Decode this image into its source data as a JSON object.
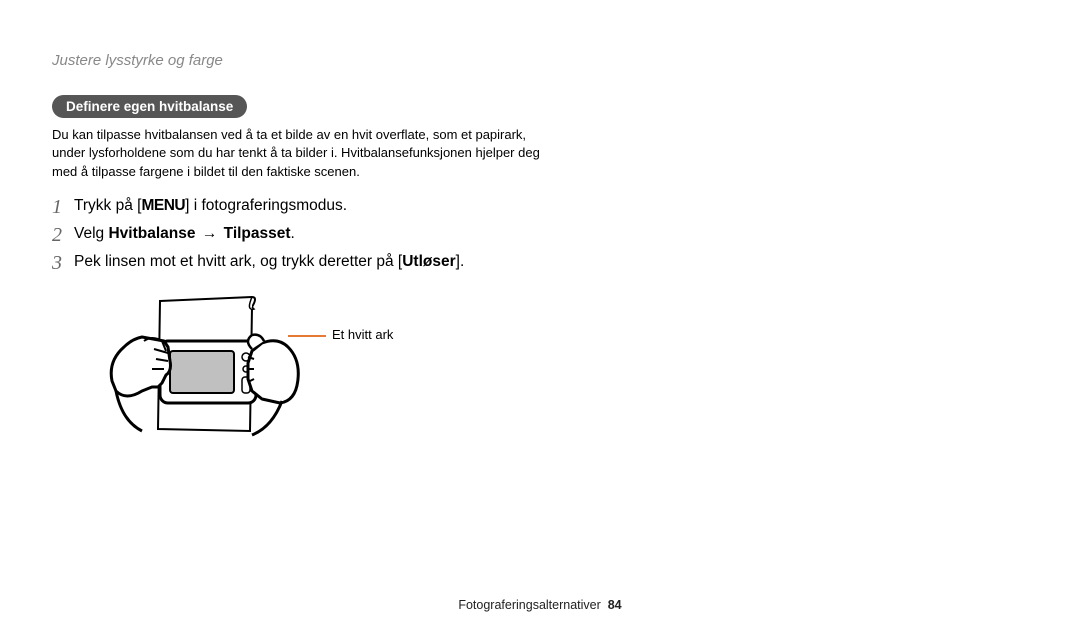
{
  "breadcrumb": "Justere lysstyrke og farge",
  "section_header": "Definere egen hvitbalanse",
  "intro": "Du kan tilpasse hvitbalansen ved å ta et bilde av en hvit overflate, som et papirark, under lysforholdene som du har tenkt å ta bilder i. Hvitbalansefunksjonen hjelper deg med å tilpasse fargene i bildet til den faktiske scenen.",
  "steps": {
    "s1": {
      "num": "1",
      "prefix": "Trykk på [",
      "menu": "MENU",
      "suffix": "] i fotograferingsmodus."
    },
    "s2": {
      "num": "2",
      "prefix": "Velg ",
      "bold1": "Hvitbalanse",
      "arrow": "→",
      "bold2": "Tilpasset",
      "suffix": "."
    },
    "s3": {
      "num": "3",
      "prefix": "Pek linsen mot et hvitt ark, og trykk deretter på [",
      "bold": "Utløser",
      "suffix": "]."
    }
  },
  "callout_label": "Et hvitt ark",
  "footer_section": "Fotograferingsalternativer",
  "footer_page": "84"
}
